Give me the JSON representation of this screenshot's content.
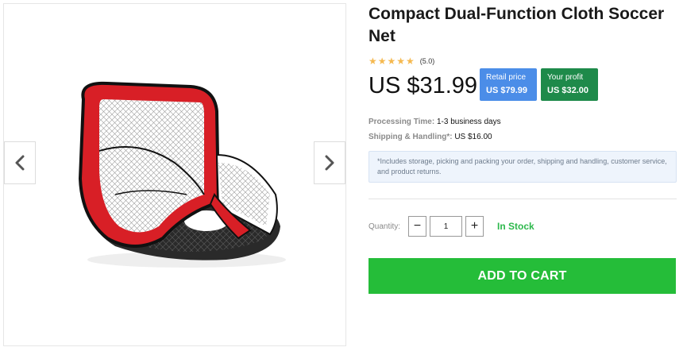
{
  "product": {
    "title": "Compact Dual-Function Cloth Soccer Net",
    "rating_stars": "★★★★★",
    "rating_value": "(5.0)",
    "price": "US $31.99"
  },
  "badges": {
    "retail_label": "Retail price",
    "retail_value": "US $79.99",
    "profit_label": "Your profit",
    "profit_value": "US $32.00"
  },
  "details": {
    "processing_label": "Processing Time:",
    "processing_value": "1-3 business days",
    "shipping_label": "Shipping & Handling*:",
    "shipping_value": "US $16.00",
    "note": "*Includes storage, picking and packing your order, shipping and handling, customer service, and product returns."
  },
  "quantity": {
    "label": "Quantity:",
    "minus": "−",
    "plus": "+",
    "value": "1",
    "stock_status": "In Stock"
  },
  "cart": {
    "label": "ADD TO CART"
  },
  "gallery": {
    "prev_icon": "chevron-left-icon",
    "next_icon": "chevron-right-icon"
  },
  "colors": {
    "accent_green": "#25bd39",
    "stock_green": "#2db84c",
    "retail_blue": "#4b8de8",
    "profit_green": "#1e8a4a",
    "net_red": "#d81f26",
    "star": "#f5b950"
  }
}
